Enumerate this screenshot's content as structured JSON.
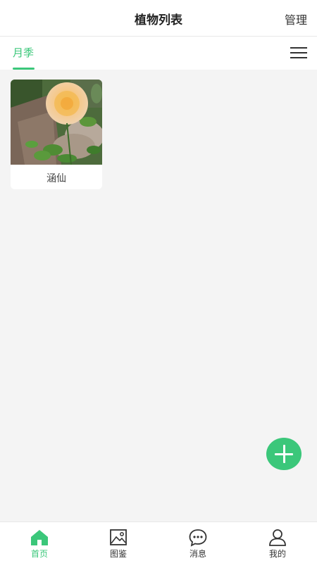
{
  "header": {
    "title": "植物列表",
    "manage_label": "管理"
  },
  "tabs": [
    {
      "label": "月季",
      "active": true
    }
  ],
  "plants": [
    {
      "name": "涵仙"
    }
  ],
  "bottom_nav": [
    {
      "label": "首页",
      "icon": "home-icon",
      "active": true
    },
    {
      "label": "图鉴",
      "icon": "image-icon",
      "active": false
    },
    {
      "label": "消息",
      "icon": "message-icon",
      "active": false
    },
    {
      "label": "我的",
      "icon": "user-icon",
      "active": false
    }
  ],
  "colors": {
    "accent": "#3bc77a",
    "background": "#f4f4f4"
  }
}
